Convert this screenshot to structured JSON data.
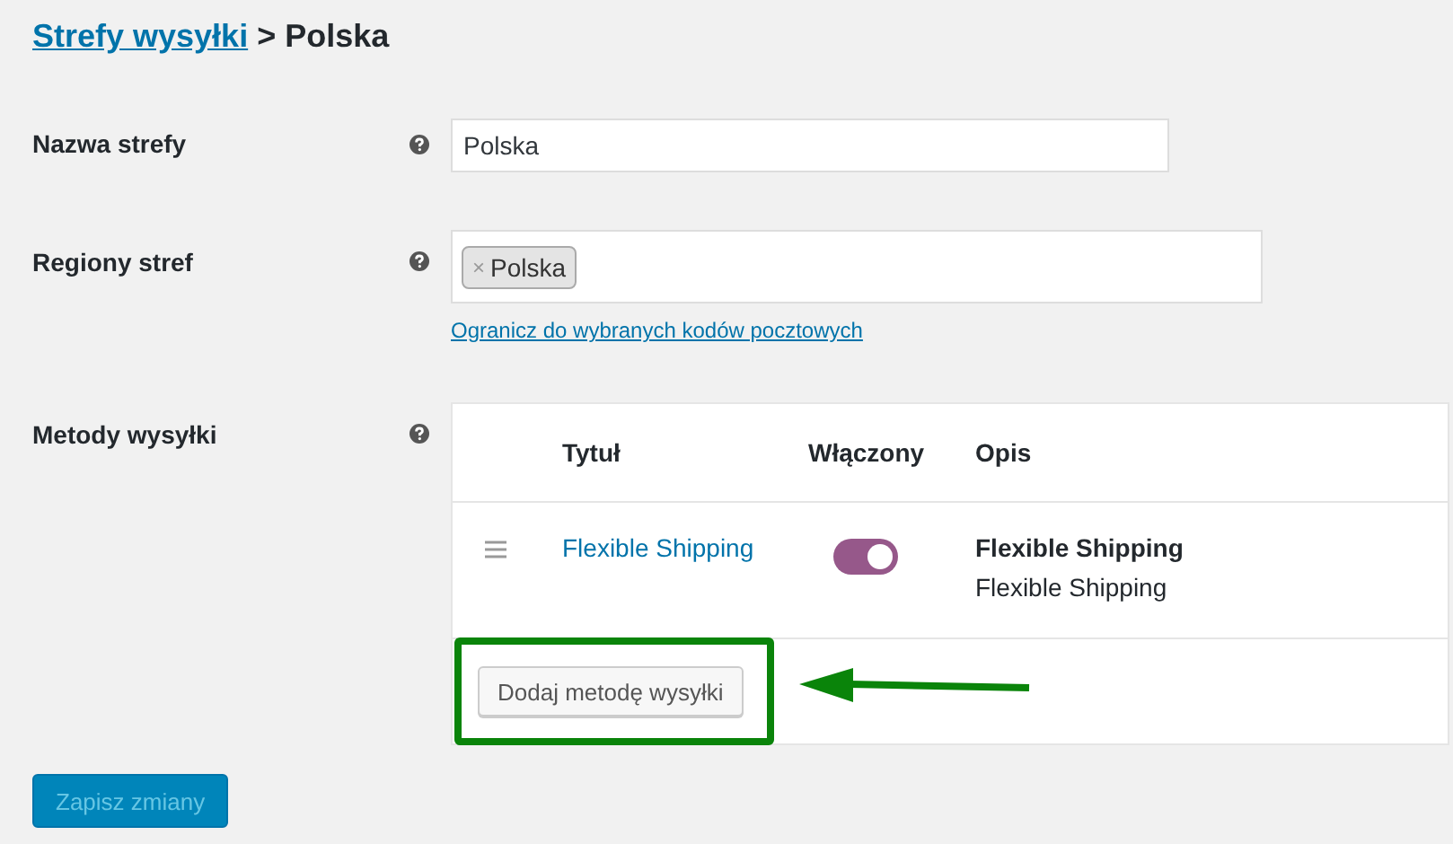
{
  "breadcrumb": {
    "link": "Strefy wysyłki",
    "separator": ">",
    "current": "Polska"
  },
  "fields": [
    {
      "kind": "text",
      "label": "Nazwa strefy",
      "value": "Polska"
    },
    {
      "kind": "tags",
      "label": "Regiony stref",
      "tags": [
        {
          "remove": "×",
          "label": "Polska"
        }
      ],
      "link": "Ogranicz do wybranych kodów pocztowych"
    },
    {
      "kind": "methods",
      "label": "Metody wysyłki"
    }
  ],
  "methods_table": {
    "columns": [
      "Tytuł",
      "Włączony",
      "Opis"
    ],
    "rows": [
      {
        "title": "Flexible Shipping",
        "enabled": true,
        "description_title": "Flexible Shipping",
        "description": "Flexible Shipping"
      }
    ],
    "add_button": "Dodaj metodę wysyłki"
  },
  "save_button": {
    "label": "Zapisz zmiany",
    "disabled": true
  }
}
